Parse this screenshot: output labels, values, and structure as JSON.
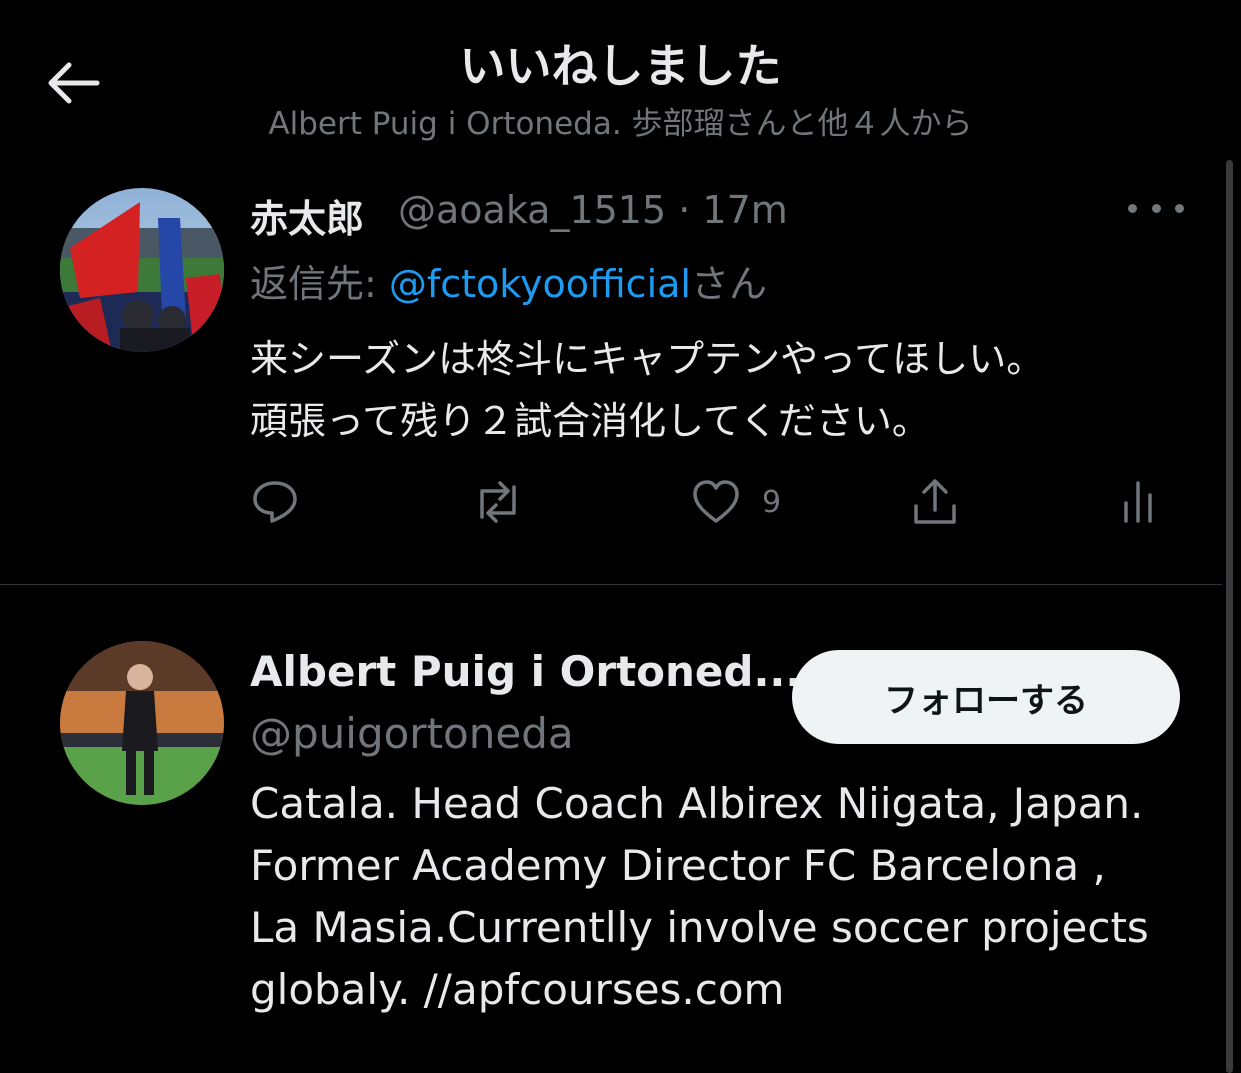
{
  "header": {
    "title": "いいねしました",
    "subtitle": "Albert Puig i Ortoneda. 歩部瑠さんと他４人から"
  },
  "tweet": {
    "display_name": "赤太郎",
    "handle_time": "@aoaka_1515 · 17m",
    "reply_prefix": "返信先: ",
    "reply_mention": "@fctokyoofficial",
    "reply_suffix": "さん",
    "text_line1": "来シーズンは柊斗にキャプテンやってほしい。",
    "text_line2": "頑張って残り２試合消化してください。",
    "like_count": "9"
  },
  "user_card": {
    "display_name": "Albert Puig i Ortoned...",
    "handle": "@puigortoneda",
    "follow_label": "フォローする",
    "bio_line1": "Catala. Head Coach Albirex Niigata, Japan.",
    "bio_line2": "Former Academy Director FC Barcelona ,",
    "bio_line3": "La Masia.Currentlly involve soccer projects",
    "bio_line4": "globaly. //apfcourses.com"
  },
  "colors": {
    "background": "#000000",
    "text_primary": "#e7e9ea",
    "text_secondary": "#71767b",
    "link": "#1d9bf0",
    "follow_button_bg": "#eff3f4"
  },
  "icons": {
    "back": "back-arrow-icon",
    "more": "more-horizontal-icon",
    "reply": "reply-bubble-icon",
    "retweet": "retweet-icon",
    "like": "heart-icon",
    "share": "share-icon",
    "analytics": "analytics-icon"
  }
}
